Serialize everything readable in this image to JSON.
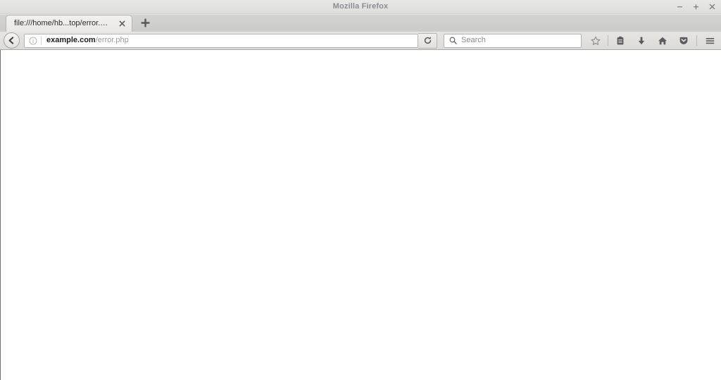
{
  "window": {
    "title": "Mozilla Firefox",
    "controls": [
      {
        "name": "minimize",
        "glyph": "minimize-icon"
      },
      {
        "name": "maximize",
        "glyph": "maximize-icon"
      },
      {
        "name": "close",
        "glyph": "close-icon"
      }
    ]
  },
  "tabs": {
    "items": [
      {
        "title": "file:///home/hb...top/error.html",
        "active": true,
        "close_icon": "close-icon"
      }
    ],
    "new_tab_icon": "plus-icon",
    "new_tab_label": ""
  },
  "toolbar": {
    "back_icon": "back-arrow-icon",
    "identity_icon": "info-icon",
    "url": {
      "host": "example.com",
      "path": "/error.php",
      "full": "example.com/error.php"
    },
    "reload_icon": "reload-icon",
    "search": {
      "icon": "search-icon",
      "placeholder": "Search",
      "value": ""
    },
    "buttons": [
      {
        "name": "bookmark",
        "icon": "star-icon",
        "label": ""
      },
      {
        "name": "library",
        "icon": "clipboard-icon",
        "label": ""
      },
      {
        "name": "downloads",
        "icon": "download-arrow-icon",
        "label": ""
      },
      {
        "name": "home",
        "icon": "home-icon",
        "label": ""
      },
      {
        "name": "pocket",
        "icon": "pocket-icon",
        "label": ""
      },
      {
        "name": "menu",
        "icon": "hamburger-menu-icon",
        "label": ""
      }
    ]
  },
  "content": {
    "body_text": "",
    "state": "blank"
  },
  "colors": {
    "titlebar_bg": "#e4e4e2",
    "tabstrip_bg": "#cfcfcd",
    "navbar_bg": "#e1e0de",
    "tab_active_bg": "#efeeec",
    "url_host_color": "#1c1c1c",
    "url_path_color": "#9a9a9a",
    "title_color": "#8f8b92",
    "content_bg": "#ffffff"
  }
}
